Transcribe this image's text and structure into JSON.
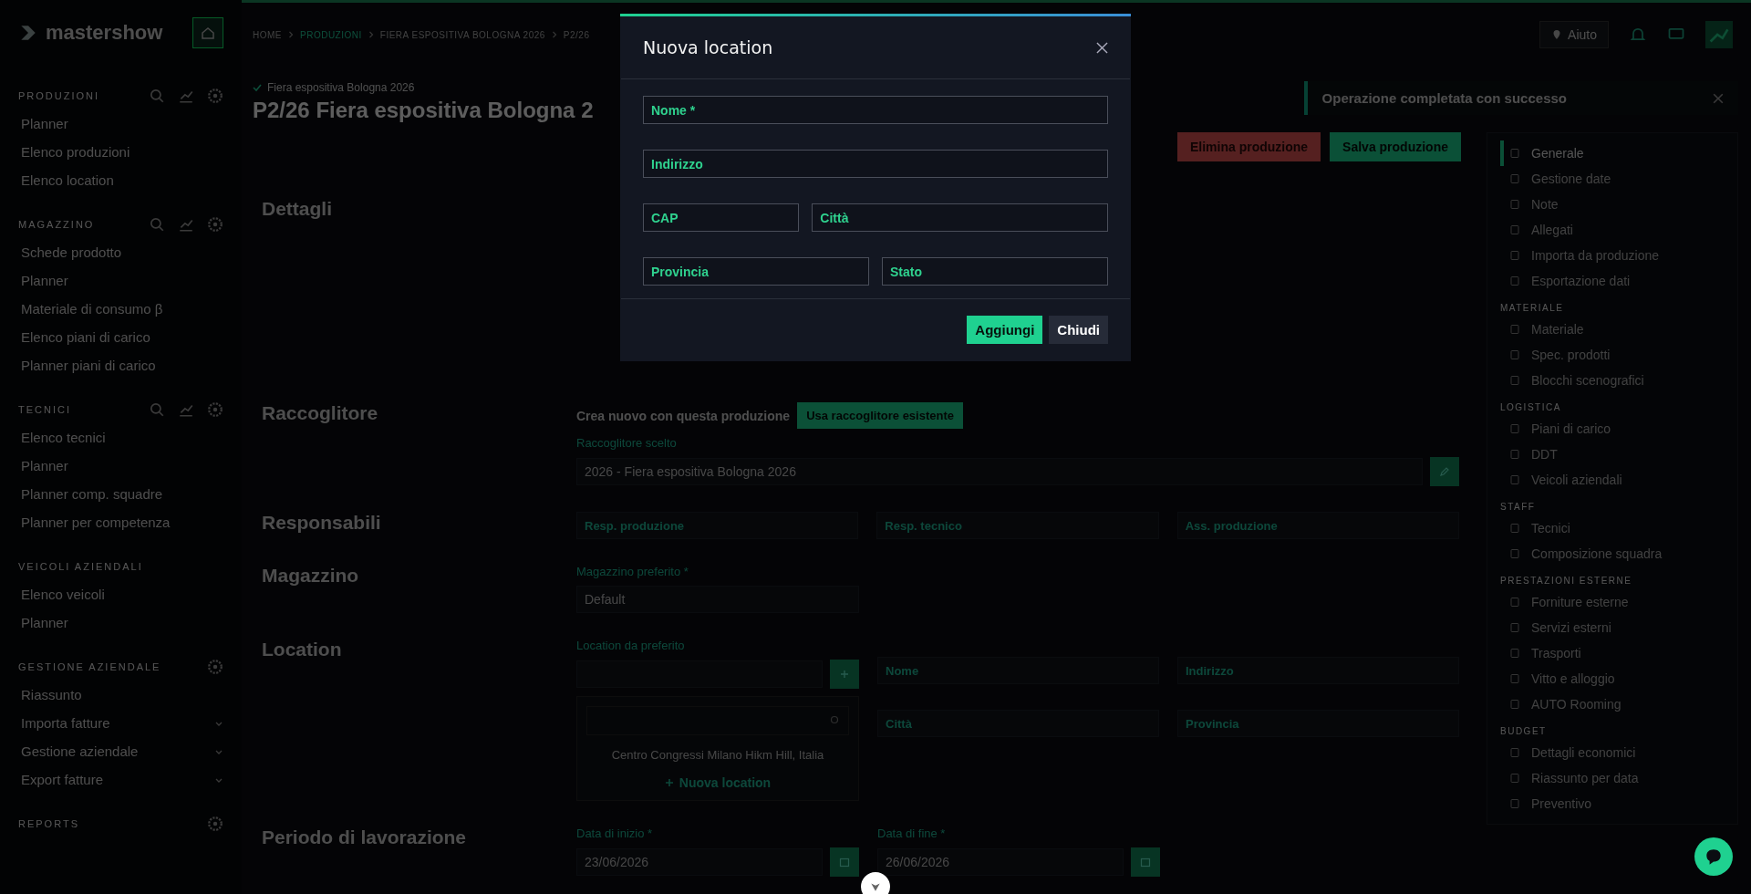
{
  "brand": {
    "name": "mastershow"
  },
  "sidebar": {
    "sections": [
      {
        "title": "PRODUZIONI",
        "kind": "tools",
        "items": [
          {
            "label": "Planner",
            "expandable": false
          },
          {
            "label": "Elenco produzioni",
            "expandable": false
          },
          {
            "label": "Elenco location",
            "expandable": false
          }
        ]
      },
      {
        "title": "MAGAZZINO",
        "kind": "tools",
        "items": [
          {
            "label": "Schede prodotto",
            "expandable": false
          },
          {
            "label": "Planner",
            "expandable": false
          },
          {
            "label": "Materiale di consumo β",
            "expandable": false
          },
          {
            "label": "Elenco piani di carico",
            "expandable": false
          },
          {
            "label": "Planner piani di carico",
            "expandable": false
          }
        ]
      },
      {
        "title": "TECNICI",
        "kind": "tools",
        "items": [
          {
            "label": "Elenco tecnici",
            "expandable": false
          },
          {
            "label": "Planner",
            "expandable": false
          },
          {
            "label": "Planner comp. squadre",
            "expandable": false
          },
          {
            "label": "Planner per competenza",
            "expandable": false
          }
        ]
      },
      {
        "title": "VEICOLI AZIENDALI",
        "kind": "plain",
        "items": [
          {
            "label": "Elenco veicoli",
            "expandable": false
          },
          {
            "label": "Planner",
            "expandable": false
          }
        ]
      },
      {
        "title": "GESTIONE AZIENDALE",
        "kind": "settings",
        "items": [
          {
            "label": "Riassunto",
            "expandable": false
          },
          {
            "label": "Importa fatture",
            "expandable": true
          },
          {
            "label": "Gestione aziendale",
            "expandable": true
          },
          {
            "label": "Export fatture",
            "expandable": true
          }
        ]
      },
      {
        "title": "REPORTS",
        "kind": "settings"
      }
    ]
  },
  "topbar": {
    "breadcrumb": [
      {
        "label": "HOME",
        "selected": false
      },
      {
        "label": "PRODUZIONI",
        "selected": true
      },
      {
        "label": "FIERA ESPOSITIVA BOLOGNA 2026",
        "selected": false
      },
      {
        "label": "P2/26",
        "selected": false
      }
    ],
    "help": "Aiuto"
  },
  "page": {
    "subtitle": "Fiera espositiva Bologna 2026",
    "title": "P2/26 Fiera espositiva Bologna 2",
    "actions": [
      {
        "label": "Elimina produzione",
        "kind": "danger"
      },
      {
        "label": "Salva produzione",
        "kind": "primary"
      }
    ],
    "toast": "Operazione completata con successo",
    "sections": [
      {
        "title": "Dettagli"
      },
      {
        "title": "Raccoglitore",
        "create_text": "Crea nuovo con questa produzione",
        "use_button": "Usa raccoglitore esistente",
        "label": "Raccoglitore scelto",
        "value": "2026 - Fiera espositiva Bologna 2026"
      },
      {
        "title": "Responsabili",
        "selects": [
          "Resp. produzione",
          "Resp. tecnico",
          "Ass. produzione"
        ]
      },
      {
        "title": "Magazzino",
        "label": "Magazzino preferito *",
        "value": "Default"
      },
      {
        "title": "Location",
        "label": "Location da preferito",
        "dropdown": {
          "option": "Centro Congressi Milano Hikm Hill, Italia",
          "add": "Nuova location"
        },
        "fields": [
          "Nome",
          "Indirizzo",
          "Città",
          "Provincia"
        ]
      },
      {
        "title": "Periodo di lavorazione",
        "dates": [
          {
            "label": "Data di inizio *",
            "value": "23/06/2026"
          },
          {
            "label": "Data di fine *",
            "value": "26/06/2026"
          }
        ]
      }
    ]
  },
  "side_nav": {
    "groups": [
      {
        "items": [
          {
            "label": "Generale",
            "selected": true
          },
          {
            "label": "Gestione date",
            "selected": false
          },
          {
            "label": "Note",
            "selected": false
          },
          {
            "label": "Allegati",
            "selected": false
          },
          {
            "label": "Importa da produzione",
            "selected": false
          },
          {
            "label": "Esportazione dati",
            "selected": false
          }
        ]
      },
      {
        "title": "MATERIALE",
        "items": [
          {
            "label": "Materiale",
            "selected": false
          },
          {
            "label": "Spec. prodotti",
            "selected": false
          },
          {
            "label": "Blocchi scenografici",
            "selected": false
          }
        ]
      },
      {
        "title": "LOGISTICA",
        "items": [
          {
            "label": "Piani di carico",
            "selected": false
          },
          {
            "label": "DDT",
            "selected": false
          },
          {
            "label": "Veicoli aziendali",
            "selected": false
          }
        ]
      },
      {
        "title": "STAFF",
        "items": [
          {
            "label": "Tecnici",
            "selected": false
          },
          {
            "label": "Composizione squadra",
            "selected": false
          }
        ]
      },
      {
        "title": "PRESTAZIONI ESTERNE",
        "items": [
          {
            "label": "Forniture esterne",
            "selected": false
          },
          {
            "label": "Servizi esterni",
            "selected": false
          },
          {
            "label": "Trasporti",
            "selected": false
          },
          {
            "label": "Vitto e alloggio",
            "selected": false
          },
          {
            "label": "AUTO Rooming",
            "selected": false
          }
        ]
      },
      {
        "title": "BUDGET",
        "items": [
          {
            "label": "Dettagli economici",
            "selected": false
          },
          {
            "label": "Riassunto per data",
            "selected": false
          },
          {
            "label": "Preventivo",
            "selected": false
          }
        ]
      }
    ]
  },
  "modal": {
    "title": "Nuova location",
    "rows": [
      [
        {
          "placeholder": "Nome *"
        }
      ],
      [
        {
          "placeholder": "Indirizzo"
        }
      ],
      [
        {
          "placeholder": "CAP"
        },
        {
          "placeholder": "Città"
        }
      ],
      [
        {
          "placeholder": "Provincia"
        },
        {
          "placeholder": "Stato"
        }
      ]
    ],
    "buttons": [
      {
        "label": "Aggiungi",
        "kind": "primary"
      },
      {
        "label": "Chiudi",
        "kind": "secondary"
      }
    ]
  }
}
